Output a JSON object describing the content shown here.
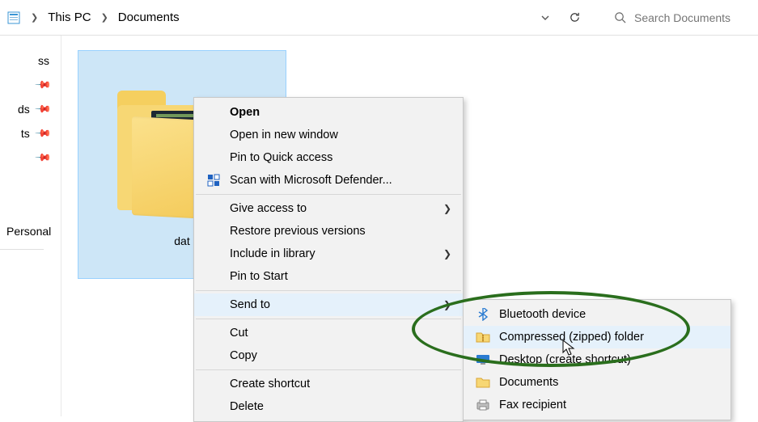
{
  "addressbar": {
    "crumb1": "This PC",
    "crumb2": "Documents",
    "search_placeholder": "Search Documents"
  },
  "sidebar": {
    "items": [
      {
        "label": "ss"
      },
      {
        "label": "ds"
      },
      {
        "label": "ts"
      },
      {
        "label": ""
      }
    ],
    "personal": "Personal"
  },
  "folder": {
    "name": "dat"
  },
  "context_menu": {
    "items": [
      {
        "label": "Open",
        "bold": true
      },
      {
        "label": "Open in new window"
      },
      {
        "label": "Pin to Quick access"
      },
      {
        "label": "Scan with Microsoft Defender...",
        "icon": "defender"
      },
      {
        "sep": true
      },
      {
        "label": "Give access to",
        "submenu": true
      },
      {
        "label": "Restore previous versions"
      },
      {
        "label": "Include in library",
        "submenu": true
      },
      {
        "label": "Pin to Start"
      },
      {
        "sep": true
      },
      {
        "label": "Send to",
        "submenu": true,
        "hover": true
      },
      {
        "sep": true
      },
      {
        "label": "Cut"
      },
      {
        "label": "Copy"
      },
      {
        "sep": true
      },
      {
        "label": "Create shortcut"
      },
      {
        "label": "Delete"
      }
    ]
  },
  "sendto_submenu": {
    "items": [
      {
        "label": "Bluetooth device",
        "icon": "bluetooth"
      },
      {
        "label": "Compressed (zipped) folder",
        "icon": "zip",
        "hover": true
      },
      {
        "label": "Desktop (create shortcut)",
        "icon": "desktop"
      },
      {
        "label": "Documents",
        "icon": "folder"
      },
      {
        "label": "Fax recipient",
        "icon": "fax"
      }
    ]
  }
}
